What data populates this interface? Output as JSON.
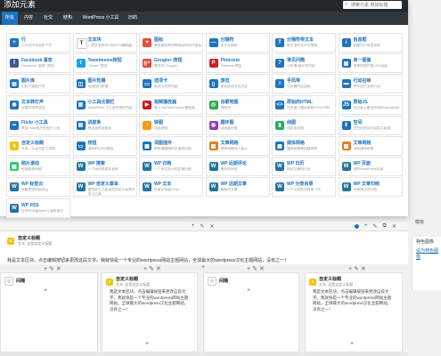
{
  "modal": {
    "title": "添加元素",
    "search_placeholder": "搜索元素 例如标题",
    "tabs": [
      "所有",
      "内容",
      "社交",
      "结构",
      "WordPress 小工具",
      "旧的"
    ],
    "active_tab": 0,
    "accent_color": "#1e73be",
    "modules": [
      {
        "name": "行",
        "desc": "可以在中添加多个栏",
        "color": "#1e73be",
        "icon": "plus-icon",
        "glyph": "+"
      },
      {
        "name": "文本块",
        "desc": "一块文本和WYSIWYG编辑器",
        "color": "#ffffff",
        "icon": "text-icon",
        "glyph": "T"
      },
      {
        "name": "图标",
        "desc": "来自图标库的带图标的用户图标",
        "color": "#e74c3c",
        "icon": "heart-icon",
        "glyph": "♥"
      },
      {
        "name": "分隔符",
        "desc": "水平分隔线",
        "color": "#1e73be",
        "icon": "separator-icon",
        "glyph": "—"
      },
      {
        "name": "分隔符带文本",
        "desc": "带文本的水平分隔线",
        "color": "#1e73be",
        "icon": "separator-text-icon",
        "glyph": "T"
      },
      {
        "name": "信息框",
        "desc": "提醒用户的信息框",
        "color": "#1e73be",
        "icon": "info-icon",
        "glyph": "i"
      },
      {
        "name": "Facebook 喜欢",
        "desc": "Facebook \"喜欢\" 按钮",
        "color": "#3b5998",
        "icon": "facebook-icon",
        "glyph": "f"
      },
      {
        "name": "Tweetmeme按钮",
        "desc": "\"Tweet\" 按钮",
        "color": "#1da1f2",
        "icon": "twitter-icon",
        "glyph": "t"
      },
      {
        "name": "Google+ 按钮",
        "desc": "推荐到 Google+",
        "color": "#dd4b39",
        "icon": "googleplus-icon",
        "glyph": "g+"
      },
      {
        "name": "Pinterest",
        "desc": "Pinterest 按钮",
        "color": "#cb2027",
        "icon": "pinterest-icon",
        "glyph": "P"
      },
      {
        "name": "常见问题",
        "desc": "可折叠/展开的内容",
        "color": "#1e73be",
        "icon": "faq-icon",
        "glyph": "?"
      },
      {
        "name": "单一图像",
        "desc": "简单的图片和CSS动画",
        "color": "#1e73be",
        "icon": "image-icon",
        "glyph": "▣"
      },
      {
        "name": "图片库",
        "desc": "幻灯片或图片库",
        "color": "#1e73be",
        "icon": "gallery-icon",
        "glyph": "▤"
      },
      {
        "name": "图片轮播",
        "desc": "动画图片轮播",
        "color": "#1e73be",
        "icon": "carousel-icon",
        "glyph": "◫"
      },
      {
        "name": "选项卡",
        "desc": "选项卡式的内容",
        "color": "#1e73be",
        "icon": "tabs-icon",
        "glyph": "▭"
      },
      {
        "name": "游览",
        "desc": "垂直选项卡式内容",
        "color": "#1e73be",
        "icon": "tour-icon",
        "glyph": "▯"
      },
      {
        "name": "手风琴",
        "desc": "可折叠内容面板",
        "color": "#1e73be",
        "icon": "accordion-icon",
        "glyph": "≡"
      },
      {
        "name": "行动召唤",
        "desc": "呼吁用户采取行动",
        "color": "#1e73be",
        "icon": "cta-icon",
        "glyph": "▬"
      },
      {
        "name": "文本转灯声",
        "desc": "谷歌文本转语音",
        "color": "#1e73be",
        "icon": "speech-icon",
        "glyph": "◉"
      },
      {
        "name": "小工具化侧栏",
        "desc": "WordPress 小工具的侧栏内容",
        "color": "#1e73be",
        "icon": "sidebar-icon",
        "glyph": "▥"
      },
      {
        "name": "视频播放器",
        "desc": "嵌入YouTube/Vimeo播放器",
        "color": "#cc181e",
        "icon": "video-icon",
        "glyph": "▶"
      },
      {
        "name": "谷歌地图",
        "desc": "地图块",
        "color": "#34a853",
        "icon": "map-icon",
        "glyph": "◎"
      },
      {
        "name": "原始的HTML",
        "desc": "在页面上输出原始HTML代码",
        "color": "#1e73be",
        "icon": "html-icon",
        "glyph": "<>"
      },
      {
        "name": "原始JS",
        "desc": "在页面上输出原始的JavaScript",
        "color": "#1e73be",
        "icon": "js-icon",
        "glyph": "JS"
      },
      {
        "name": "Flickr 小工具",
        "desc": "来自Flickr帐户的图片订阅",
        "color": "#1e73be",
        "icon": "flickr-icon",
        "glyph": "••"
      },
      {
        "name": "进度条",
        "desc": "带动画的进度条",
        "color": "#1e73be",
        "icon": "progress-icon",
        "glyph": "▤"
      },
      {
        "name": "饼图",
        "desc": "动画饼图",
        "color": "#f39c12",
        "icon": "pie-icon",
        "glyph": "◔"
      },
      {
        "name": "圆环图",
        "desc": "动画圆环图",
        "color": "#8e44ad",
        "icon": "donut-icon",
        "glyph": "◍"
      },
      {
        "name": "线图",
        "desc": "线和条形图",
        "color": "#27ae60",
        "icon": "linechart-icon",
        "glyph": "▮"
      },
      {
        "name": "空间",
        "desc": "空白的空间与自定义高度",
        "color": "#1e73be",
        "icon": "space-icon",
        "glyph": "⇕"
      },
      {
        "name": "自定义标题",
        "desc": "文本，以及自定义字体",
        "color": "#f1c40f",
        "icon": "heading-icon",
        "glyph": "a"
      },
      {
        "name": "按钮",
        "desc": "漂亮的CSS3按钮",
        "color": "#1e73be",
        "icon": "button-icon",
        "glyph": "▭"
      },
      {
        "name": "词图插件",
        "desc": "带有缩略图的文章和页面",
        "color": "#1e73be",
        "icon": "postgrid-icon",
        "glyph": "▦"
      },
      {
        "name": "文章网格",
        "desc": "砌体网格帖子展示",
        "color": "#e67e22",
        "icon": "masonry-icon",
        "glyph": "▦"
      },
      {
        "name": "媒体网格",
        "desc": "媒体网格来自媒体库",
        "color": "#1e73be",
        "icon": "mediagrid-icon",
        "glyph": "▦"
      },
      {
        "name": "文章网格",
        "desc": "砌体媒体网格",
        "color": "#e67e22",
        "icon": "masonry-media-icon",
        "glyph": "▦"
      },
      {
        "name": "砌片滚动",
        "desc": "砌体媒体网格",
        "color": "#2ecc71",
        "icon": "scroll-icon",
        "glyph": "▦"
      },
      {
        "name": "WP 搜索",
        "desc": "一个网站的搜索表单",
        "color": "#21759b",
        "icon": "wp-search-icon",
        "glyph": "W"
      },
      {
        "name": "WP 归档",
        "desc": "一个按月显示的文章归档",
        "color": "#21759b",
        "icon": "wp-archive-icon",
        "glyph": "W"
      },
      {
        "name": "WP 近期评论",
        "desc": "最近的评论",
        "color": "#21759b",
        "icon": "wp-comments-icon",
        "glyph": "W"
      },
      {
        "name": "WP 日历",
        "desc": "网站文章的日历",
        "color": "#21759b",
        "icon": "wp-calendar-icon",
        "glyph": "W"
      },
      {
        "name": "WP 页面",
        "desc": "您的WordPress页面",
        "color": "#21759b",
        "icon": "wp-pages-icon",
        "glyph": "W"
      },
      {
        "name": "WP 标签云",
        "desc": "您最常用的标签云",
        "color": "#21759b",
        "icon": "wp-tagcloud-icon",
        "glyph": "W"
      },
      {
        "name": "WP 自定义菜单",
        "desc": "使用此小工具添加自定义菜单作为小工具",
        "color": "#21759b",
        "icon": "wp-menu-icon",
        "glyph": "W"
      },
      {
        "name": "WP 文本",
        "desc": "任意文本或HTML",
        "color": "#21759b",
        "icon": "wp-text-icon",
        "glyph": "W"
      },
      {
        "name": "WP 近期文章",
        "desc": "最新的文章",
        "color": "#21759b",
        "icon": "wp-posts-icon",
        "glyph": "W"
      },
      {
        "name": "WP 分类目录",
        "desc": "一个分类的列表或下拉",
        "color": "#21759b",
        "icon": "wp-categories-icon",
        "glyph": "W"
      },
      {
        "name": "WP 文章归档",
        "desc": "文章按月的归档",
        "color": "#21759b",
        "icon": "wp-post-archive-icon",
        "glyph": "W"
      },
      {
        "name": "WP RSS",
        "desc": "任何RSS或Atom订阅的条目",
        "color": "#21759b",
        "icon": "wp-rss-icon",
        "glyph": "W"
      }
    ]
  },
  "background": {
    "row1": {
      "title": "自定义标题",
      "subtitle": "文本: 这是自定义标题",
      "text": "我是文本区块，点击编辑按钮来更改这段文字。我就快是一个专业的wordpress网站主题网站，全球最大的wordpress汉化主题网站，没有之一！"
    },
    "columns": [
      {
        "title": "间隔",
        "subtitle": "",
        "text": ""
      },
      {
        "title": "自定义标题",
        "subtitle": "文本: 这是自定义标题",
        "text": "我是文本区块，点击编辑按钮来更改这段文字。我就快是一个专业的wordpress网站主题网站，全球最大的wordpress汉化主题网站，没有之一！"
      },
      {
        "title": "间隔",
        "subtitle": "",
        "text": ""
      },
      {
        "title": "自定义标题",
        "subtitle": "文本: 这是自定义标题",
        "text": "我是文本区块，点击编辑按钮来更改这段文字。我就快是一个专业的wordpress网站主题网站，全球最大的wordpress汉化主题网站，没有之一！"
      }
    ],
    "sidebar_box": {
      "label": "特色图像",
      "link": "设为特色图像",
      "top_label": "模板"
    }
  }
}
